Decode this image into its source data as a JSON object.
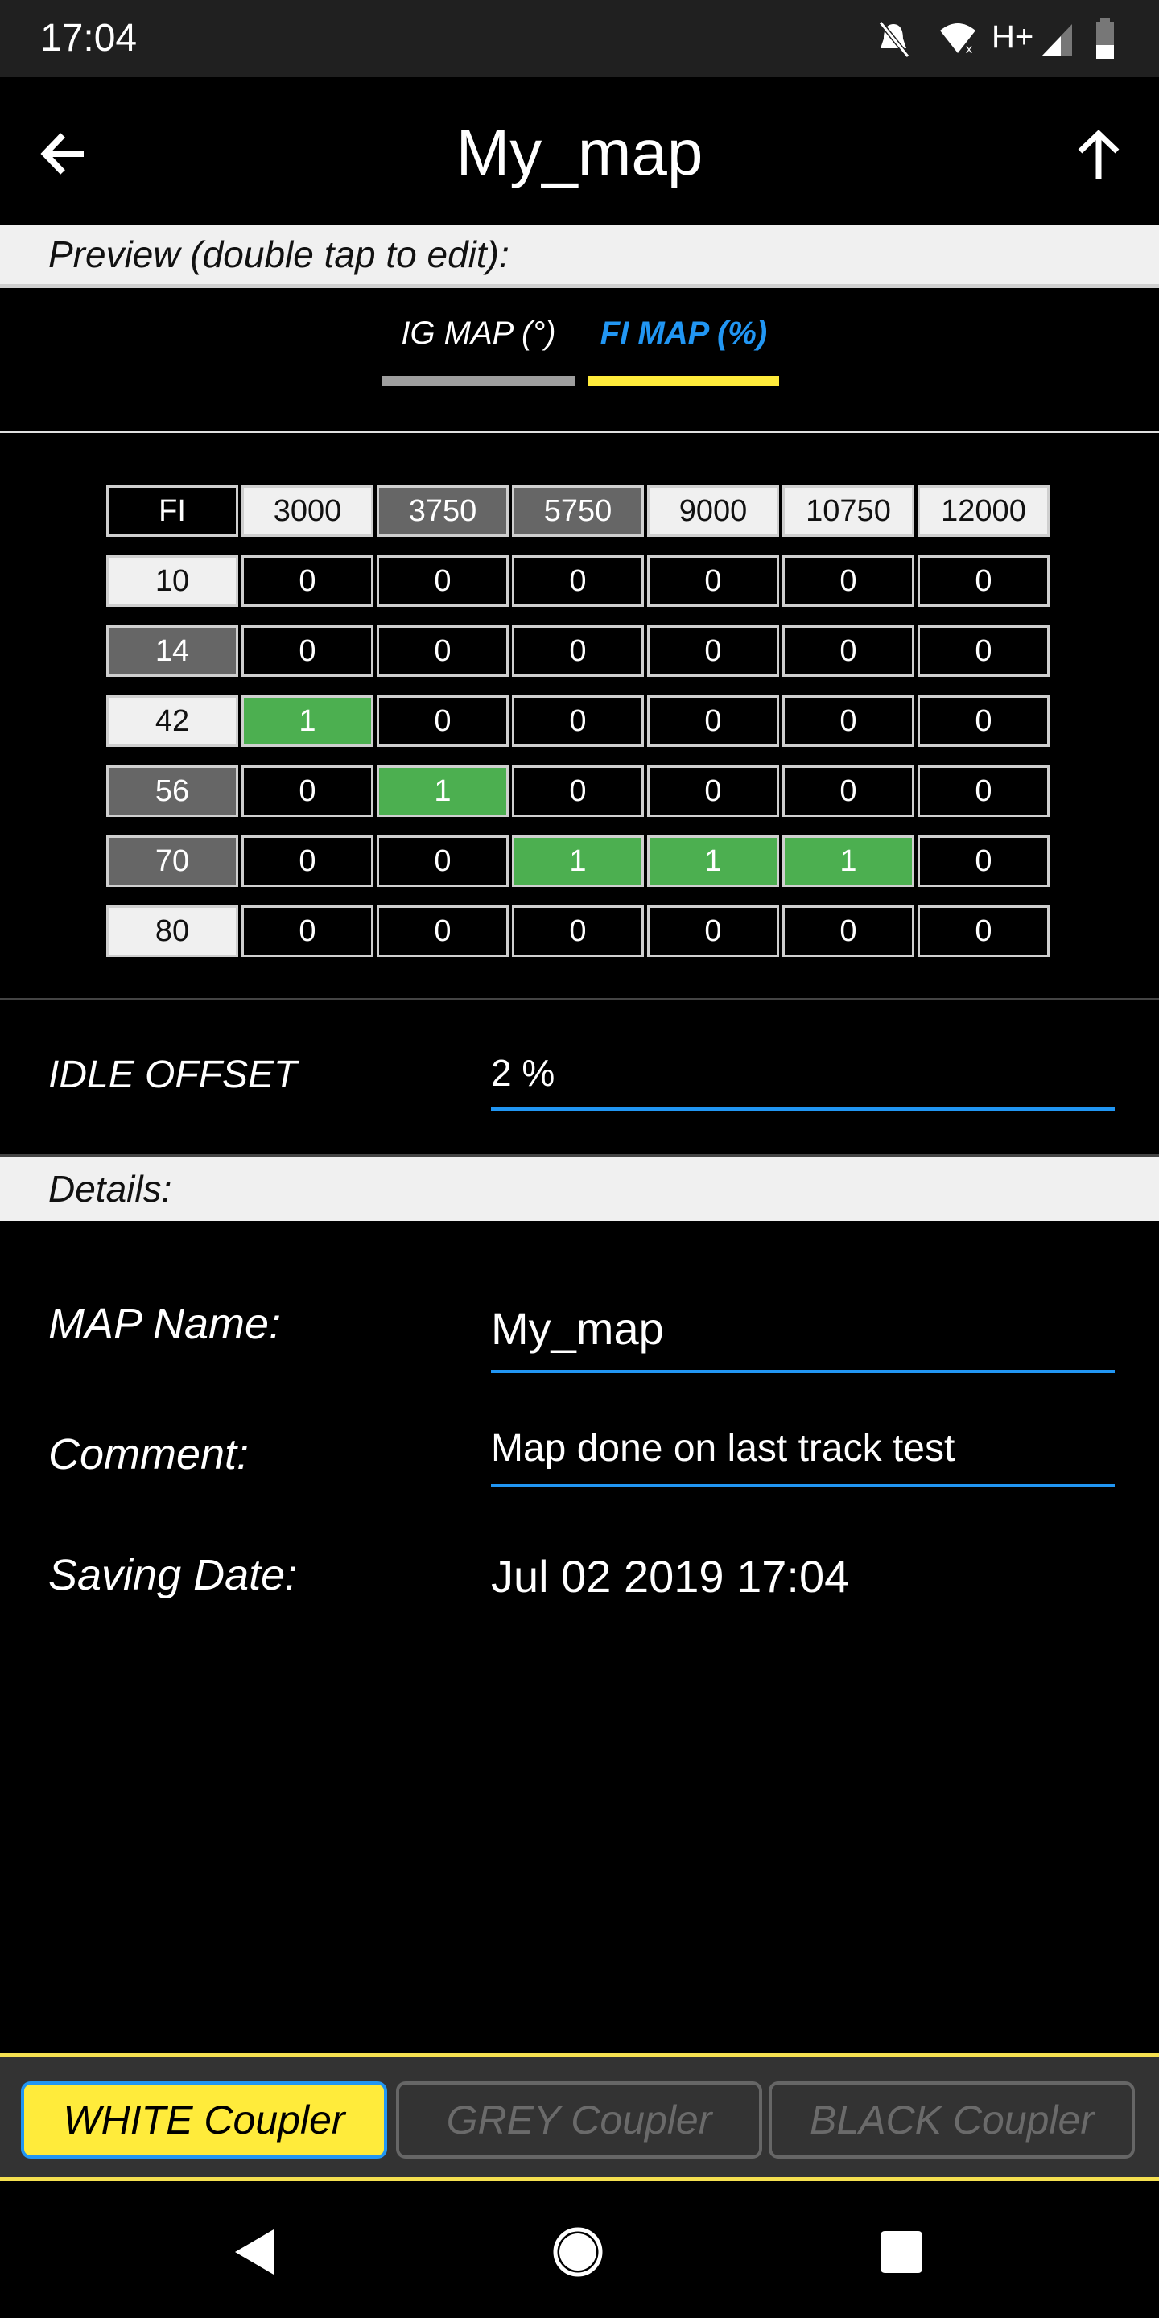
{
  "status_bar": {
    "time": "17:04",
    "network": "H+",
    "icons": [
      "bell-off-icon",
      "wifi-x-icon",
      "signal-icon",
      "battery-icon"
    ]
  },
  "toolbar": {
    "title": "My_map",
    "back_icon": "arrow-left-icon",
    "upload_icon": "arrow-up-icon"
  },
  "preview": {
    "header": "Preview (double tap to edit):",
    "tabs": [
      {
        "label": "IG MAP (°)",
        "active": false,
        "bar_color": "#9e9e9e"
      },
      {
        "label": "FI MAP (%)",
        "active": true,
        "bar_color": "#ffeb3b"
      }
    ]
  },
  "table": {
    "corner": "FI",
    "columns": [
      {
        "label": "3000",
        "shade": "light"
      },
      {
        "label": "3750",
        "shade": "dark"
      },
      {
        "label": "5750",
        "shade": "dark"
      },
      {
        "label": "9000",
        "shade": "light"
      },
      {
        "label": "10750",
        "shade": "light"
      },
      {
        "label": "12000",
        "shade": "light"
      }
    ],
    "rows": [
      {
        "label": "10",
        "shade": "light",
        "values": [
          "0",
          "0",
          "0",
          "0",
          "0",
          "0"
        ]
      },
      {
        "label": "14",
        "shade": "dark",
        "values": [
          "0",
          "0",
          "0",
          "0",
          "0",
          "0"
        ]
      },
      {
        "label": "42",
        "shade": "light",
        "values": [
          "1",
          "0",
          "0",
          "0",
          "0",
          "0"
        ]
      },
      {
        "label": "56",
        "shade": "dark",
        "values": [
          "0",
          "1",
          "0",
          "0",
          "0",
          "0"
        ]
      },
      {
        "label": "70",
        "shade": "dark",
        "values": [
          "0",
          "0",
          "1",
          "1",
          "1",
          "0"
        ]
      },
      {
        "label": "80",
        "shade": "light",
        "values": [
          "0",
          "0",
          "0",
          "0",
          "0",
          "0"
        ]
      }
    ],
    "highlight_color": "#4caf50"
  },
  "idle_offset": {
    "label": "IDLE OFFSET",
    "value": "2 %"
  },
  "details": {
    "header": "Details:",
    "map_name": {
      "label": "MAP Name:",
      "value": "My_map"
    },
    "comment": {
      "label": "Comment:",
      "value": "Map done on last track test"
    },
    "saving_date": {
      "label": "Saving Date:",
      "value": "Jul 02 2019 17:04"
    }
  },
  "couplers": [
    {
      "label": "WHITE Coupler",
      "selected": true
    },
    {
      "label": "GREY Coupler",
      "selected": false
    },
    {
      "label": "BLACK Coupler",
      "selected": false
    }
  ],
  "colors": {
    "accent": "#2196f3",
    "selected": "#ffeb3b",
    "border": "#f5e050"
  }
}
